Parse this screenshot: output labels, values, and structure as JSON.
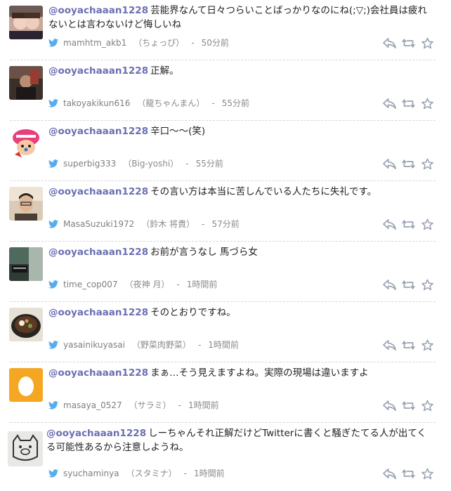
{
  "tweets": [
    {
      "mention": "@ooyachaaan1228",
      "text": "芸能界なんて日々つらいことばっかりなのにね(;▽;)会社員は疲れないとは言わないけど悔しいね",
      "username": "mamhtm_akb1",
      "display_name": "（ちょっぴ）",
      "time": "50分前"
    },
    {
      "mention": "@ooyachaaan1228",
      "text": "正解。",
      "username": "takoyakikun616",
      "display_name": "（龍ちゃんまん）",
      "time": "55分前"
    },
    {
      "mention": "@ooyachaaan1228",
      "text": "辛口～～(笑)",
      "username": "superbig333",
      "display_name": "（Big-yoshi）",
      "time": "55分前"
    },
    {
      "mention": "@ooyachaaan1228",
      "text": "その言い方は本当に苦しんでいる人たちに失礼です。",
      "username": "MasaSuzuki1972",
      "display_name": "（鈴木 将貴）",
      "time": "57分前"
    },
    {
      "mention": "@ooyachaaan1228",
      "text": "お前が言うなし 馬づら女",
      "username": "time_cop007",
      "display_name": "（夜神 月）",
      "time": "1時間前"
    },
    {
      "mention": "@ooyachaaan1228",
      "text": "そのとおりですね。",
      "username": "yasainikuyasai",
      "display_name": "（野菜肉野菜）",
      "time": "1時間前"
    },
    {
      "mention": "@ooyachaaan1228",
      "text": "まぁ…そう見えますよね。実際の現場は違いますよ",
      "username": "masaya_0527",
      "display_name": "（サラミ）",
      "time": "1時間前"
    },
    {
      "mention": "@ooyachaaan1228",
      "text": "しーちゃんそれ正解だけどTwitterに書くと騒ぎたてる人が出てくる可能性あるから注意しようね。",
      "username": "syuchaminya",
      "display_name": "（スタミナ）",
      "time": "1時間前"
    }
  ],
  "meta": {
    "separator": "-"
  },
  "colors": {
    "mention": "#6b6fb3",
    "bird": "#55acee",
    "icon": "#9aa2b1"
  },
  "icons": {
    "reply": "reply-icon",
    "retweet": "retweet-icon",
    "favorite": "star-icon",
    "bird": "twitter-bird-icon"
  }
}
